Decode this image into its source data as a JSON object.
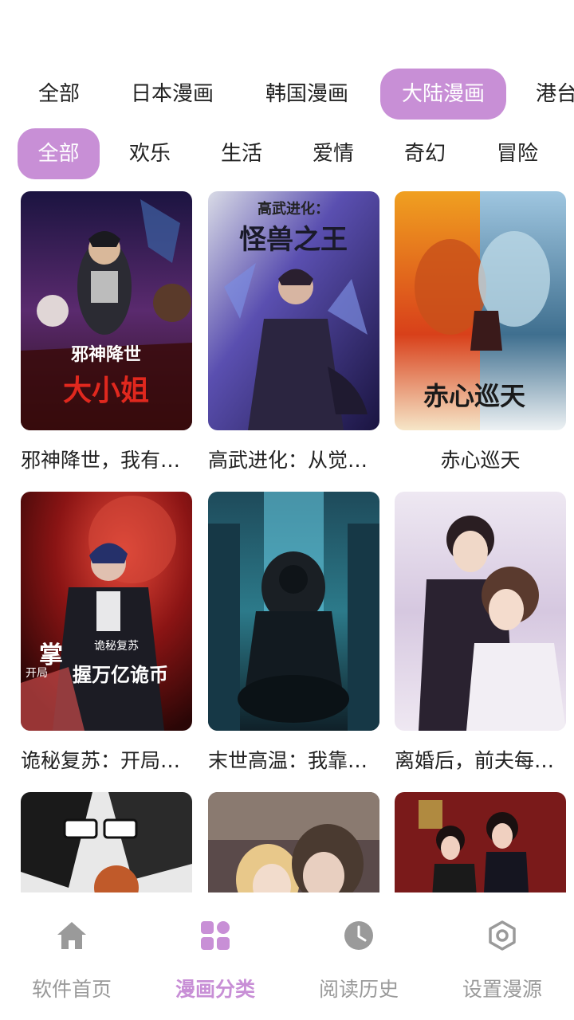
{
  "region_tabs": [
    {
      "label": "全部",
      "active": false
    },
    {
      "label": "日本漫画",
      "active": false
    },
    {
      "label": "韩国漫画",
      "active": false
    },
    {
      "label": "大陆漫画",
      "active": true
    },
    {
      "label": "港台",
      "active": false
    }
  ],
  "genre_tabs": [
    {
      "label": "全部",
      "active": true
    },
    {
      "label": "欢乐",
      "active": false
    },
    {
      "label": "生活",
      "active": false
    },
    {
      "label": "爱情",
      "active": false
    },
    {
      "label": "奇幻",
      "active": false
    },
    {
      "label": "冒险",
      "active": false
    }
  ],
  "comics": [
    {
      "title": "邪神降世，我有…",
      "cover_text": "邪神降世 大小姐"
    },
    {
      "title": "高武进化：从觉…",
      "cover_text": "高武进化： 怪兽之王"
    },
    {
      "title": "赤心巡天",
      "cover_text": "赤心巡天"
    },
    {
      "title": "诡秘复苏：开局…",
      "cover_text": "诡秘复苏 开局 掌握万亿诡币"
    },
    {
      "title": "末世高温：我靠…",
      "cover_text": ""
    },
    {
      "title": "离婚后，前夫每…",
      "cover_text": ""
    },
    {
      "title": "",
      "cover_text": ""
    },
    {
      "title": "",
      "cover_text": ""
    },
    {
      "title": "",
      "cover_text": ""
    }
  ],
  "bottom_nav": [
    {
      "label": "软件首页",
      "icon": "home-icon",
      "active": false
    },
    {
      "label": "漫画分类",
      "icon": "grid-icon",
      "active": true
    },
    {
      "label": "阅读历史",
      "icon": "clock-icon",
      "active": false
    },
    {
      "label": "设置漫源",
      "icon": "settings-hex-icon",
      "active": false
    }
  ],
  "colors": {
    "accent": "#c88fd6",
    "inactive": "#9a9a9a"
  }
}
